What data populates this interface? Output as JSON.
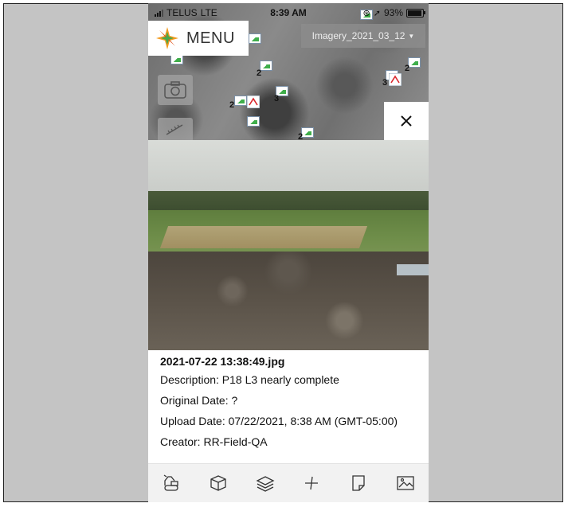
{
  "status_bar": {
    "carrier": "TELUS",
    "network": "LTE",
    "time": "8:39 AM",
    "battery": "93%",
    "battery_level": 0.93,
    "icons": [
      "signal-icon",
      "orientation-lock-icon",
      "location-icon",
      "battery-icon"
    ]
  },
  "map": {
    "menu_label": "MENU",
    "imagery_label": "Imagery_2021_03_12",
    "clusters": [
      "2",
      "2",
      "3",
      "2",
      "3",
      "2",
      "2"
    ],
    "tools": [
      "camera-icon",
      "ruler-icon"
    ]
  },
  "photo_panel": {
    "filename": "2021-07-22 13:38:49.jpg",
    "description": "Description: P18 L3 nearly complete",
    "original_date": "Original Date: ?",
    "upload_date": "Upload Date: 07/22/2021, 8:38 AM (GMT-05:00)",
    "creator": "Creator: RR-Field-QA"
  },
  "toolbar": {
    "items": [
      "excavator-icon",
      "cube-icon",
      "layers-icon",
      "compass-icon",
      "note-icon",
      "image-icon"
    ]
  },
  "colors": {
    "frame": "#c4c4c4",
    "logo_orange": "#f39a1e",
    "logo_green": "#4aa84a",
    "marker_green": "#3fae4b"
  }
}
